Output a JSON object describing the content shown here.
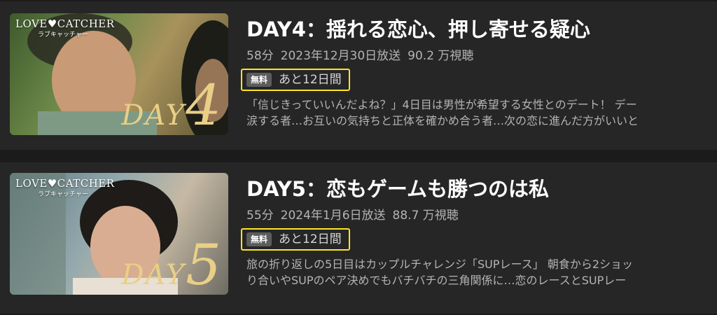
{
  "episodes": [
    {
      "thumbnail": {
        "logo": "LOVE♥CATCHER",
        "logo_sub": "ラブキャッチャー",
        "day_word": "DAY",
        "day_number": "4"
      },
      "title": "DAY4：揺れる恋心、押し寄せる疑心",
      "duration": "58分",
      "air_date": "2023年12月30日放送",
      "views": "90.2 万視聴",
      "badge": "無料",
      "remaining": "あと12日間",
      "description_lines": [
        "「信じきっていいんだよね？」4日目は男性が希望する女性とのデート！ デー",
        "涙する者…お互いの気持ちと正体を確かめ合う者…次の恋に進んだ方がいいと"
      ]
    },
    {
      "thumbnail": {
        "logo": "LOVE♥CATCHER",
        "logo_sub": "ラブキャッチャー",
        "day_word": "DAY",
        "day_number": "5"
      },
      "title": "DAY5：恋もゲームも勝つのは私",
      "duration": "55分",
      "air_date": "2024年1月6日放送",
      "views": "88.7 万視聴",
      "badge": "無料",
      "remaining": "あと12日間",
      "description_lines": [
        "旅の折り返しの5日目はカップルチャレンジ「SUPレース」 朝食から2ショッ",
        "り合いやSUPのペア決めでもバチバチの三角関係に…恋のレースとSUPレー"
      ]
    }
  ],
  "colors": {
    "background": "#1b1b1b",
    "card": "#262626",
    "highlight_border": "#ffe526",
    "badge": "#5c5c5c",
    "day_mark": "#e9cf86"
  }
}
